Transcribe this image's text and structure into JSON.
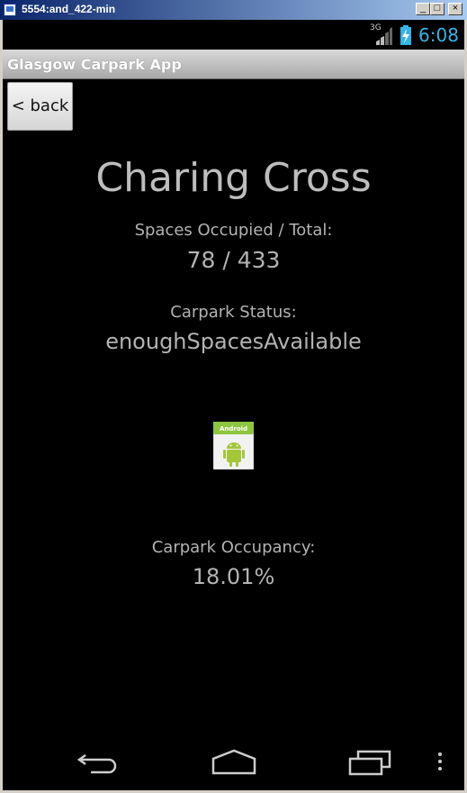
{
  "window": {
    "title": "5554:and_422-min",
    "min_glyph": "_",
    "max_glyph": "□",
    "close_glyph": "×"
  },
  "status_bar": {
    "network": "3G",
    "time": "6:08"
  },
  "action_bar": {
    "title": "Glasgow Carpark App"
  },
  "back_button": {
    "label": "< back"
  },
  "carpark": {
    "name": "Charing Cross",
    "spaces_label": "Spaces Occupied / Total:",
    "spaces_value": "78 / 433",
    "status_label": "Carpark Status:",
    "status_value": "enoughSpacesAvailable",
    "occupancy_label": "Carpark Occupancy:",
    "occupancy_value": "18.01%",
    "image_icon": "android-icon",
    "image_text": "Android"
  },
  "nav_bar": {
    "icons": [
      "back-icon",
      "home-icon",
      "recent-apps-icon",
      "overflow-menu-icon"
    ]
  },
  "colors": {
    "clock": "#33b5e5",
    "text": "#b3b3b3",
    "screen_bg": "#000000"
  }
}
